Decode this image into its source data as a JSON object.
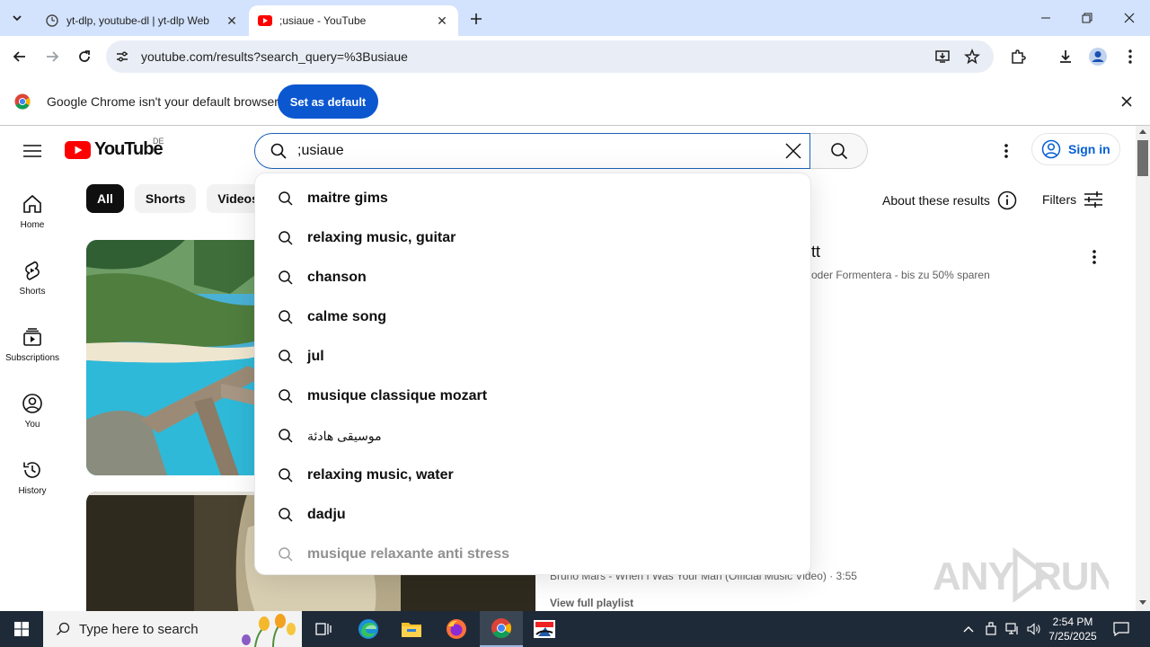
{
  "browser": {
    "tabs": [
      {
        "title": "yt-dlp, youtube-dl | yt-dlp Web",
        "active": false
      },
      {
        "title": ";usiaue - YouTube",
        "active": true
      }
    ],
    "url": "youtube.com/results?search_query=%3Busiaue"
  },
  "infobar": {
    "message": "Google Chrome isn't your default browser",
    "button": "Set as default"
  },
  "youtube": {
    "logo_text": "YouTube",
    "region": "DE",
    "search_query": ";usiaue",
    "sign_in": "Sign in",
    "sidebar": [
      {
        "label": "Home",
        "icon": "home-icon"
      },
      {
        "label": "Shorts",
        "icon": "shorts-icon"
      },
      {
        "label": "Subscriptions",
        "icon": "subscriptions-icon"
      },
      {
        "label": "You",
        "icon": "you-icon"
      },
      {
        "label": "History",
        "icon": "history-icon"
      }
    ],
    "chips": [
      "All",
      "Shorts",
      "Videos"
    ],
    "about_results": "About these results",
    "filters": "Filters",
    "result1": {
      "title_fragment": "tt",
      "subtitle_fragment": "oder Formentera - bis zu 50% sparen"
    },
    "result2": {
      "playlist_item": "Bruno Mars - When I Was Your Man (Official Music Video) · 3:55",
      "view_playlist": "View full playlist"
    },
    "suggestions": [
      "maitre gims",
      "relaxing music, guitar",
      "chanson",
      "calme song",
      "jul",
      "musique classique mozart",
      "موسيقى هادئة",
      "relaxing music, water",
      "dadju",
      "musique relaxante anti stress"
    ]
  },
  "watermark": "ANY RUN",
  "taskbar": {
    "search_placeholder": "Type here to search",
    "time": "2:54 PM",
    "date": "7/25/2025"
  },
  "colors": {
    "tabstrip": "#d3e3fd",
    "chrome_blue": "#0b57d0",
    "youtube_red": "#ff0000",
    "link_blue": "#065fd4",
    "taskbar": "#1f2a38"
  }
}
